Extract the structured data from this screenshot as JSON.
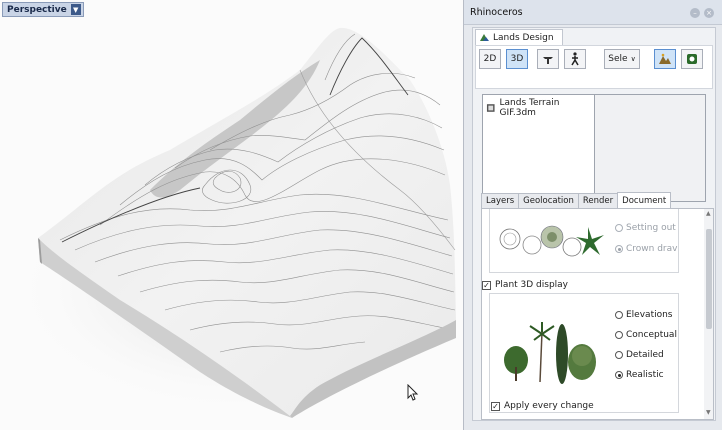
{
  "viewport": {
    "label": "Perspective"
  },
  "panel": {
    "title": "Rhinoceros",
    "tab_label": "Lands Design",
    "toolbar": {
      "btn_2d": "2D",
      "btn_3d": "3D",
      "select_label": "Sele"
    },
    "files": [
      "Lands Terrain GIF.3dm"
    ],
    "tabs": [
      "Layers",
      "Geolocation",
      "Render",
      "Document"
    ],
    "active_tab": "Document",
    "document": {
      "setting_out_label": "Setting out",
      "crown_draw_label": "Crown drav",
      "plant3d_label": "Plant 3D display",
      "display_options": [
        "Elevations",
        "Conceptual",
        "Detailed",
        "Realistic"
      ],
      "selected_option": "Realistic",
      "apply_label": "Apply every change"
    }
  }
}
